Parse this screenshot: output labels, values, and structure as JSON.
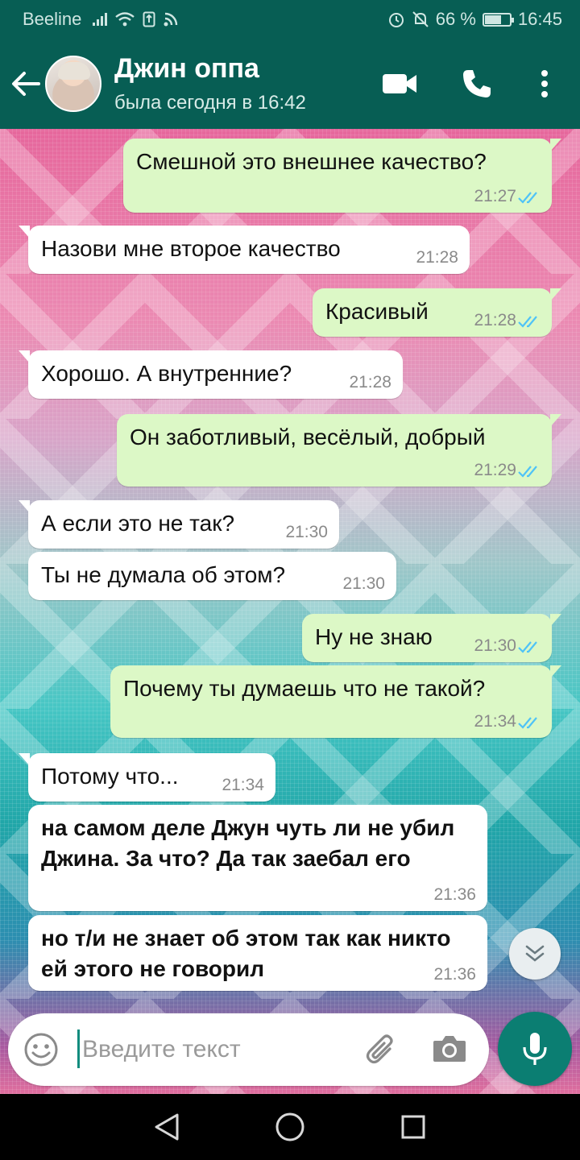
{
  "status_bar": {
    "carrier": "Beeline",
    "battery": "66 %",
    "battery_level": 0.66,
    "time": "16:45"
  },
  "header": {
    "contact_name": "Джин оппа",
    "contact_status": "была сегодня в 16:42",
    "icons": [
      "back-arrow-icon",
      "video-call-icon",
      "phone-icon",
      "more-vert-icon"
    ]
  },
  "messages": [
    {
      "dir": "out",
      "text": "Смешной это внешнее качество?",
      "time": "21:27",
      "read": true
    },
    {
      "dir": "in",
      "text": "Назови мне второе качество",
      "time": "21:28"
    },
    {
      "dir": "out",
      "text": "Красивый",
      "time": "21:28",
      "read": true
    },
    {
      "dir": "in",
      "text": "Хорошо. А внутренние?",
      "time": "21:28"
    },
    {
      "dir": "out",
      "text": "Он заботливый, весёлый, добрый",
      "time": "21:29",
      "read": true
    },
    {
      "dir": "in",
      "text": "А если это не так?",
      "time": "21:30"
    },
    {
      "dir": "in",
      "text": "Ты не думала об этом?",
      "time": "21:30"
    },
    {
      "dir": "out",
      "text": "Ну не знаю",
      "time": "21:30",
      "read": true
    },
    {
      "dir": "out",
      "text": "Почему ты думаешь что не такой?",
      "time": "21:34",
      "read": true
    },
    {
      "dir": "in",
      "text": "Потому что...",
      "time": "21:34"
    },
    {
      "dir": "in",
      "text": "на самом деле Джун чуть ли не убил Джина. За что? Да так заебал его",
      "time": "21:36"
    },
    {
      "dir": "in",
      "text": "но т/и не знает об этом так как никто ей этого не говорил",
      "time": "21:36"
    }
  ],
  "input": {
    "placeholder": "Введите текст",
    "value": ""
  },
  "colors": {
    "header": "#075e54",
    "outgoing_bubble": "#dcf8c6",
    "incoming_bubble": "#ffffff",
    "read_ticks": "#4fc3f7",
    "mic_button": "#0b7e72"
  }
}
